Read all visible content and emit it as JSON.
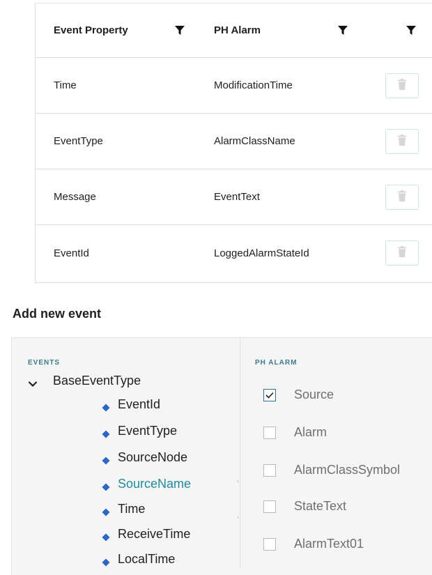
{
  "table": {
    "headers": {
      "property": "Event Property",
      "alarm": "PH Alarm"
    },
    "rows": [
      {
        "property": "Time",
        "alarm": "ModificationTime"
      },
      {
        "property": "EventType",
        "alarm": "AlarmClassName"
      },
      {
        "property": "Message",
        "alarm": "EventText"
      },
      {
        "property": "EventId",
        "alarm": "LoggedAlarmStateId"
      }
    ]
  },
  "add_event": {
    "title": "Add new event",
    "events_label": "EVENTS",
    "alarm_label": "PH ALARM",
    "tree_root": "BaseEventType",
    "tree_items": [
      "EventId",
      "EventType",
      "SourceNode",
      "SourceName",
      "Time",
      "ReceiveTime",
      "LocalTime"
    ],
    "selected_item": "SourceName",
    "alarm_fields": [
      {
        "label": "Source",
        "checked": true
      },
      {
        "label": "Alarm",
        "checked": false
      },
      {
        "label": "AlarmClassSymbol",
        "checked": false
      },
      {
        "label": "StateText",
        "checked": false
      },
      {
        "label": "AlarmText01",
        "checked": false
      }
    ]
  },
  "colors": {
    "accent": "#1f8c9c",
    "checkbox_border_checked": "#2b6f8a",
    "trash_icon": "#d6d6d6"
  }
}
